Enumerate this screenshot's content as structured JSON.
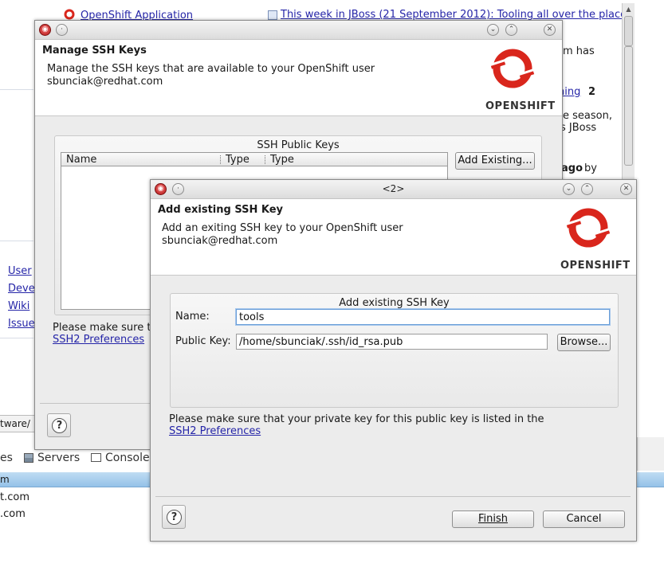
{
  "background": {
    "top_link_left": "OpenShift Application",
    "top_link_right": "This week in JBoss (21 September 2012): Tooling all over the place",
    "frag_has": "m has",
    "frag_hing": "hing",
    "frag_2": "2",
    "frag_season": "e season,",
    "frag_jboss": "s JBoss",
    "frag_ago": "ago",
    "frag_by": "by",
    "left_links": [
      "User",
      "Deve",
      "Wiki",
      "Issue"
    ],
    "status_text": "tware/",
    "bottom_tabs": [
      "es",
      "Servers",
      "Console"
    ],
    "bottom_rows": [
      "m",
      "t.com",
      ".com"
    ]
  },
  "manage_dialog": {
    "title": "Manage SSH Keys",
    "description_line1": "Manage the SSH keys that are available to your OpenShift user",
    "description_line2": "sbunciak@redhat.com",
    "logo_text": "OPENSHIFT",
    "group_title": "SSH Public Keys",
    "columns": [
      "Name",
      "Type",
      "Type"
    ],
    "add_existing_label": "Add Existing...",
    "note_fragment": "Please make sure t",
    "ssh2_link": "SSH2 Preferences",
    "help_symbol": "?"
  },
  "add_dialog": {
    "window_title": "<2>",
    "title": "Add existing SSH Key",
    "description_line1": "Add an exiting SSH key to your OpenShift user",
    "description_line2": "sbunciak@redhat.com",
    "logo_text": "OPENSHIFT",
    "group_title": "Add existing SSH Key",
    "name_label": "Name:",
    "name_value": "tools",
    "public_key_label": "Public Key:",
    "public_key_value": "/home/sbunciak/.ssh/id_rsa.pub",
    "browse_label": "Browse...",
    "note": "Please make sure that your private key for this public key is listed in the",
    "ssh2_link": "SSH2 Preferences",
    "finish_label": "Finish",
    "cancel_label": "Cancel",
    "help_symbol": "?"
  },
  "icons": {
    "close": "close-icon",
    "minimize": "minimize-icon",
    "maximize": "maximize-icon",
    "menu": "window-menu-icon",
    "pin": "pin-icon",
    "openshift_logo": "openshift-logo-icon",
    "help": "help-icon",
    "feed": "feed-icon",
    "servers": "servers-icon",
    "console": "console-icon"
  },
  "colors": {
    "link": "#2525a8",
    "openshift_red": "#d9261c",
    "focus_border": "#6a9ed8",
    "dialog_bg": "#ececec",
    "bottom_header": "#a9cfee"
  }
}
